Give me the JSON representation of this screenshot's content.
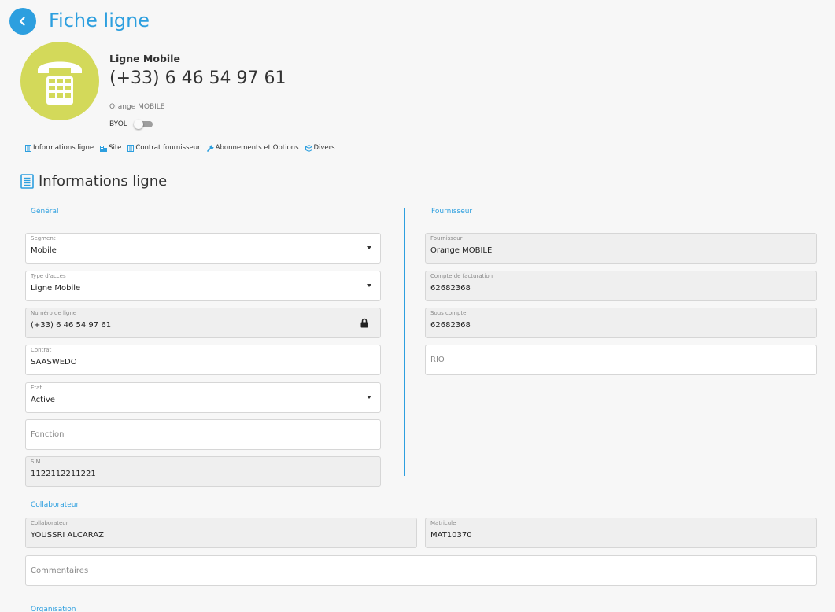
{
  "header": {
    "title": "Fiche ligne"
  },
  "line": {
    "type": "Ligne Mobile",
    "number": "(+33) 6 46 54 97 61",
    "operator": "Orange MOBILE",
    "byol_label": "BYOL",
    "byol_enabled": false
  },
  "nav": {
    "tabs": [
      {
        "label": "Informations ligne",
        "icon": "document-icon"
      },
      {
        "label": "Site",
        "icon": "building-icon"
      },
      {
        "label": "Contrat fournisseur",
        "icon": "document-icon"
      },
      {
        "label": "Abonnements et Options",
        "icon": "wrench-icon"
      },
      {
        "label": "Divers",
        "icon": "box-icon"
      }
    ]
  },
  "section": {
    "title": "Informations ligne"
  },
  "general": {
    "label": "Général",
    "segment": {
      "label": "Segment",
      "value": "Mobile"
    },
    "access_type": {
      "label": "Type d'accès",
      "value": "Ligne Mobile"
    },
    "line_number": {
      "label": "Numéro de ligne",
      "value": "(+33) 6 46 54 97 61"
    },
    "contract": {
      "label": "Contrat",
      "value": "SAASWEDO"
    },
    "state": {
      "label": "Etat",
      "value": "Active"
    },
    "function": {
      "placeholder": "Fonction"
    },
    "sim": {
      "label": "SIM",
      "value": "1122112211221"
    }
  },
  "supplier": {
    "label": "Fournisseur",
    "supplier": {
      "label": "Fournisseur",
      "value": "Orange MOBILE"
    },
    "billing_account": {
      "label": "Compte de facturation",
      "value": "62682368"
    },
    "sub_account": {
      "label": "Sous compte",
      "value": "62682368"
    },
    "rio": {
      "placeholder": "RIO"
    }
  },
  "collaborator": {
    "label": "Collaborateur",
    "name": {
      "label": "Collaborateur",
      "value": "YOUSSRI ALCARAZ"
    },
    "matricule": {
      "label": "Matricule",
      "value": "MAT10370"
    },
    "comments": {
      "placeholder": "Commentaires"
    }
  },
  "organisation": {
    "label": "Organisation"
  },
  "colors": {
    "accent": "#2d9fdf",
    "avatar_bg": "#d3d95a"
  }
}
